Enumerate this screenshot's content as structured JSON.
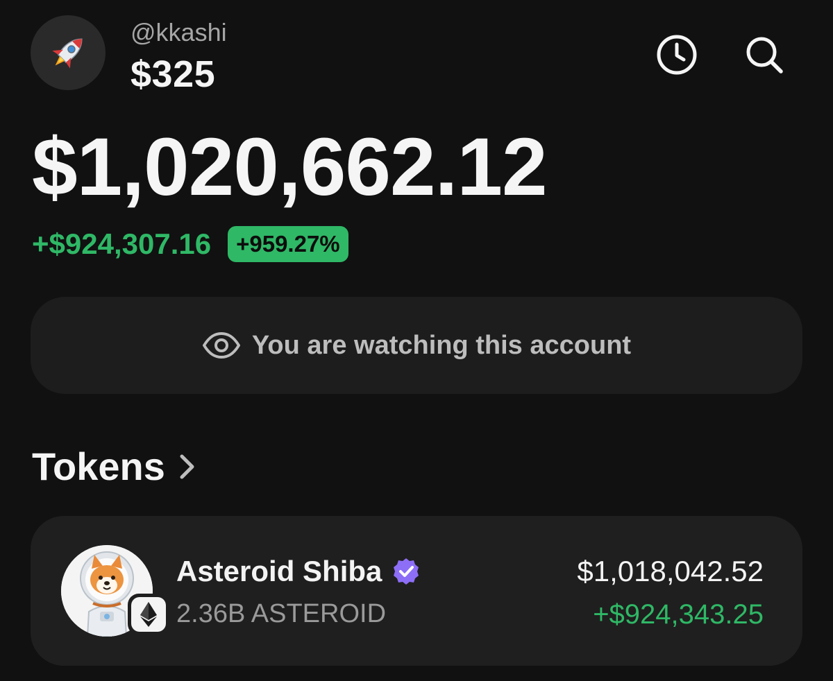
{
  "header": {
    "avatar_icon": "rocket-icon",
    "handle": "@kkashi",
    "small_balance": "$325",
    "actions": [
      {
        "name": "history",
        "icon": "clock-icon"
      },
      {
        "name": "search",
        "icon": "search-icon"
      }
    ]
  },
  "portfolio": {
    "balance": "$1,020,662.12",
    "change_amount": "+$924,307.16",
    "change_percent": "+959.27%"
  },
  "watching_banner": {
    "icon": "eye-icon",
    "text": "You are watching this account"
  },
  "tokens_section": {
    "title": "Tokens",
    "chevron_icon": "chevron-right-icon",
    "items": [
      {
        "name": "Asteroid Shiba",
        "verified": true,
        "amount": "2.36B ASTEROID",
        "value": "$1,018,042.52",
        "change": "+$924,343.25",
        "chain_icon": "ethereum-icon",
        "logo_icon": "shiba-astronaut-icon"
      }
    ]
  },
  "colors": {
    "background": "#111111",
    "card": "#1f1f1f",
    "positive": "#2fb866",
    "verified": "#8d6ef7",
    "muted_text": "#9a9a9a"
  }
}
